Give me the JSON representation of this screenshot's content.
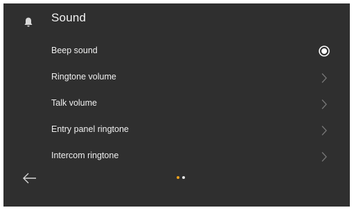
{
  "header": {
    "title": "Sound",
    "icon": "bell-icon"
  },
  "menu": {
    "items": [
      {
        "label": "Beep sound",
        "control": "radio-selected-icon"
      },
      {
        "label": "Ringtone volume",
        "control": "chevron-right-icon"
      },
      {
        "label": "Talk volume",
        "control": "chevron-right-icon"
      },
      {
        "label": "Entry panel ringtone",
        "control": "chevron-right-icon"
      },
      {
        "label": "Intercom ringtone",
        "control": "chevron-right-icon"
      }
    ]
  },
  "footer": {
    "back_icon": "arrow-left-icon",
    "page_indicator": {
      "pages": 2,
      "current": 1
    }
  },
  "colors": {
    "background": "#2f2f2f",
    "text": "#efefef",
    "accent": "#f2a21b",
    "muted": "#777777"
  }
}
